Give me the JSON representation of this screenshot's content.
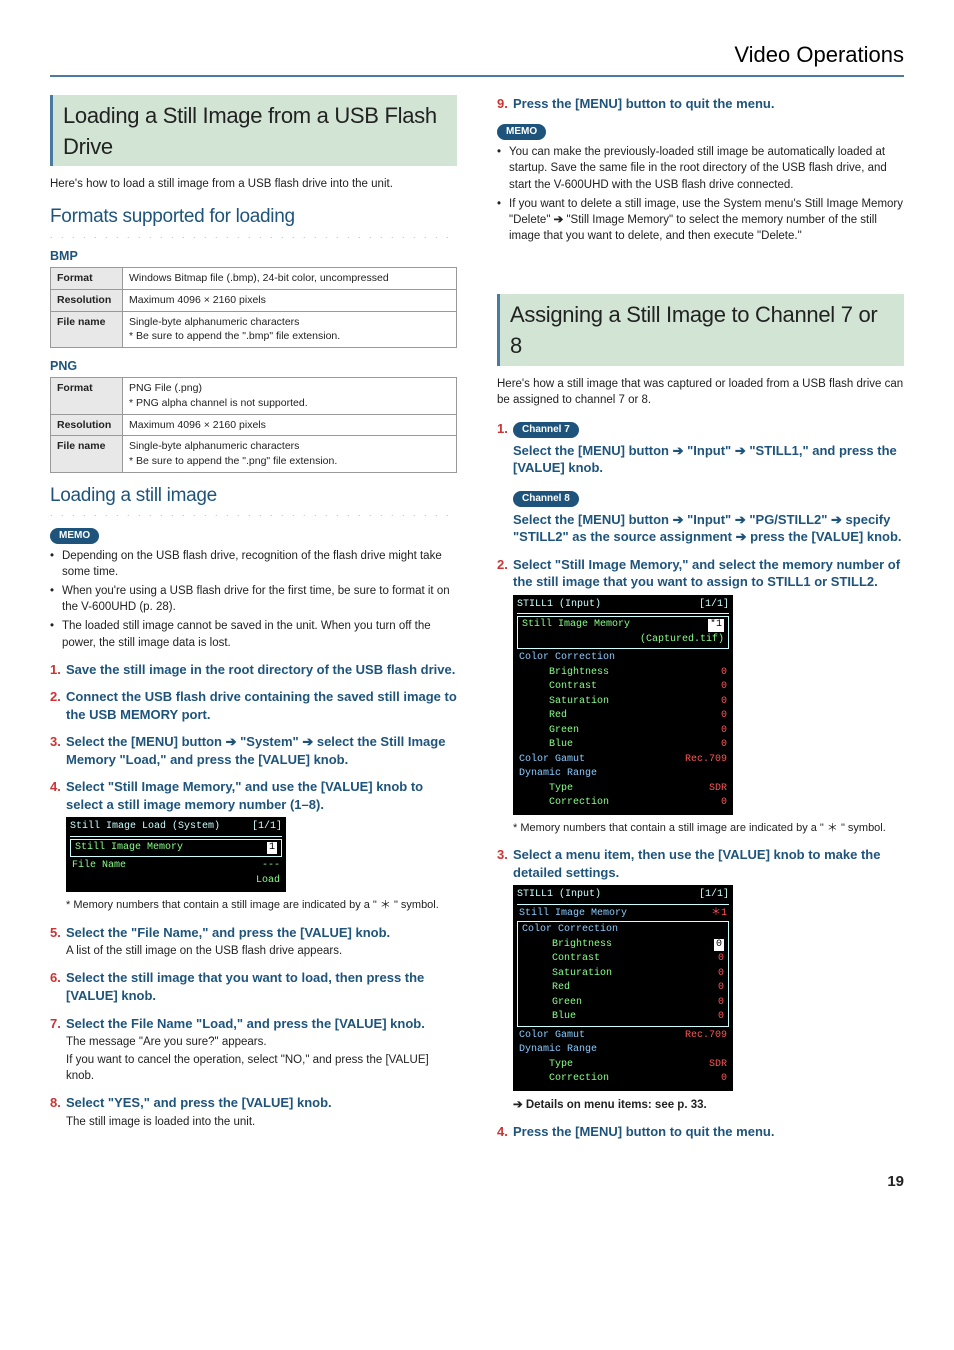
{
  "breadcrumb": "Video Operations",
  "pageNum": "19",
  "colL": {
    "h2": "Loading a Still Image from a USB Flash Drive",
    "intro": "Here's how to load a still image from a USB flash drive into the unit.",
    "h3a": "Formats supported for loading",
    "bmp": {
      "title": "BMP",
      "rows": {
        "format_h": "Format",
        "format_v": "Windows Bitmap file (.bmp), 24-bit color, uncompressed",
        "res_h": "Resolution",
        "res_v": "Maximum 4096 × 2160 pixels",
        "file_h": "File name",
        "file_v1": "Single-byte alphanumeric characters",
        "file_v2": "*  Be sure to append the \".bmp\" file extension."
      }
    },
    "png": {
      "title": "PNG",
      "rows": {
        "format_h": "Format",
        "format_v1": "PNG File (.png)",
        "format_v2": "*  PNG alpha channel is not supported.",
        "res_h": "Resolution",
        "res_v": "Maximum 4096 × 2160 pixels",
        "file_h": "File name",
        "file_v1": "Single-byte alphanumeric characters",
        "file_v2": "*  Be sure to append the \".png\" file extension."
      }
    },
    "h3b": "Loading a still image",
    "memo": "MEMO",
    "memo_items": {
      "a": "Depending on the USB flash drive, recognition of the flash drive might take some time.",
      "b": "When you're using a USB flash drive for the first time, be sure to format it on the V-600UHD (p. 28).",
      "c": "The loaded still image cannot be saved in the unit. When you turn off the power, the still image data is lost."
    },
    "steps": {
      "s1": "Save the still image in the root directory of the USB flash drive.",
      "s2": "Connect the USB flash drive containing the saved still image to the USB MEMORY port.",
      "s3_a": "Select the [MENU] button ",
      "s3_b": " \"System\" ",
      "s3_c": " select the Still Image Memory \"Load,\" and press the [VALUE] knob.",
      "s4": "Select \"Still Image Memory,\" and use the [VALUE] knob to select a still image memory number (1–8).",
      "shot1": {
        "title": "Still Image Load (System)",
        "page": "[1/1]",
        "r1": "Still Image Memory",
        "r1v": "1",
        "r2": "File Name",
        "r2v": "---",
        "r3": "Load"
      },
      "note1": "*  Memory numbers that contain a still image are indicated by a \" ＊ \" symbol.",
      "s5h": "Select the \"File Name,\" and press the [VALUE] knob.",
      "s5b": "A list of the still image on the USB flash drive appears.",
      "s6": "Select the still image that you want to load, then press the [VALUE] knob.",
      "s7h": "Select the File Name \"Load,\" and press the [VALUE] knob.",
      "s7b1": "The message \"Are you sure?\" appears.",
      "s7b2": "If you want to cancel the operation, select \"NO,\" and press the [VALUE] knob.",
      "s8h": "Select \"YES,\" and press the [VALUE] knob.",
      "s8b": "The still image is loaded into the unit."
    }
  },
  "colR": {
    "s9": "Press the [MENU] button to quit the menu.",
    "memo": "MEMO",
    "memo_items": {
      "a": "You can make the previously-loaded still image be automatically loaded at startup. Save the same file in the root directory of the USB flash drive, and start the V-600UHD with the USB flash drive connected.",
      "b_a": "If you want to delete a still image, use the System menu's Still Image Memory \"Delete\" ",
      "b_b": " \"Still Image Memory\" to select the memory number of the still image that you want to delete, and then execute \"Delete.\""
    },
    "h2": "Assigning a Still Image to Channel 7 or 8",
    "intro": "Here's how a still image that was captured or loaded from a USB flash drive can be assigned to channel 7 or 8.",
    "steps": {
      "s1": {
        "ch7": "Channel 7",
        "ch7_a": "Select the [MENU] button ",
        "ch7_b": " \"Input\" ",
        "ch7_c": " \"STILL1,\" and press the [VALUE] knob.",
        "ch8": "Channel 8",
        "ch8_a": "Select the [MENU] button ",
        "ch8_b": " \"Input\" ",
        "ch8_c": " \"PG/STILL2\" ",
        "ch8_d": " specify \"STILL2\" as the source assignment ",
        "ch8_e": " press the [VALUE] knob."
      },
      "s2": "Select \"Still Image Memory,\" and select the memory number of the still image that you want to assign to STILL1 or STILL2.",
      "shot1": {
        "title": "STILL1 (Input)",
        "page": "[1/1]",
        "r1": "Still Image Memory",
        "r1v": "*1",
        "r1sub": "(Captured.tif)",
        "cc": "Color Correction",
        "br": "Brightness",
        "brv": "0",
        "co": "Contrast",
        "cov": "0",
        "sa": "Saturation",
        "sav": "0",
        "re": "Red",
        "rev": "0",
        "gr": "Green",
        "grv": "0",
        "bl": "Blue",
        "blv": "0",
        "cg": "Color Gamut",
        "cgv": "Rec.709",
        "dr": "Dynamic Range",
        "ty": "Type",
        "tyv": "SDR",
        "cr": "Correction",
        "crv": "0"
      },
      "note1": "*  Memory numbers that contain a still image are indicated by a \" ＊ \" symbol.",
      "s3": "Select a menu item, then use the [VALUE] knob to make the detailed settings.",
      "shot2_r1v": "＊1",
      "det": " Details on menu items: see p. 33.",
      "s4": "Press the [MENU] button to quit the menu."
    }
  }
}
